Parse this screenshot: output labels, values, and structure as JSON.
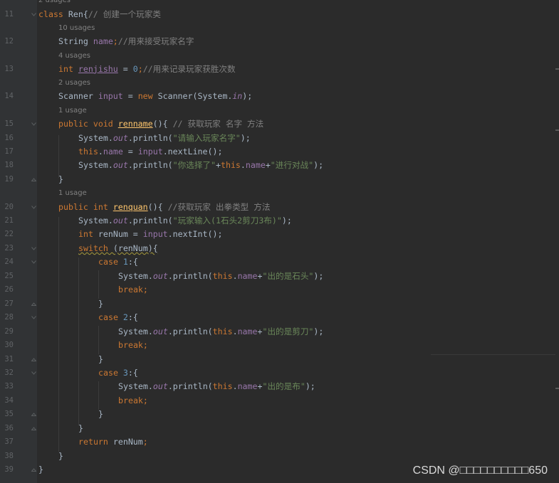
{
  "editor": {
    "top_hint": "2 usages",
    "lines": [
      {
        "kind": "code",
        "num": "11",
        "fold": "open",
        "indent": 0,
        "tokens": [
          {
            "t": "class ",
            "c": "kw"
          },
          {
            "t": "Ren{",
            "c": "p"
          },
          {
            "t": "// 创建一个玩家类",
            "c": "cmt"
          }
        ]
      },
      {
        "kind": "hint",
        "indent": 1,
        "text": "10 usages"
      },
      {
        "kind": "code",
        "num": "12",
        "indent": 1,
        "tokens": [
          {
            "t": "String ",
            "c": "p"
          },
          {
            "t": "name",
            "c": "fld"
          },
          {
            "t": ";",
            "c": "kw"
          },
          {
            "t": "//用来接受玩家名字",
            "c": "cmt"
          }
        ]
      },
      {
        "kind": "hint",
        "indent": 1,
        "text": "4 usages"
      },
      {
        "kind": "code",
        "num": "13",
        "indent": 1,
        "tokens": [
          {
            "t": "int ",
            "c": "kw"
          },
          {
            "t": "renjishu",
            "c": "fldu"
          },
          {
            "t": " = ",
            "c": "p"
          },
          {
            "t": "0",
            "c": "num"
          },
          {
            "t": ";",
            "c": "kw"
          },
          {
            "t": "//用来记录玩家获胜次数",
            "c": "cmt"
          }
        ]
      },
      {
        "kind": "hint",
        "indent": 1,
        "text": "2 usages"
      },
      {
        "kind": "code",
        "num": "14",
        "indent": 1,
        "tokens": [
          {
            "t": "Scanner ",
            "c": "p"
          },
          {
            "t": "input",
            "c": "fld"
          },
          {
            "t": " = ",
            "c": "p"
          },
          {
            "t": "new ",
            "c": "kw"
          },
          {
            "t": "Scanner(System.",
            "c": "p"
          },
          {
            "t": "in",
            "c": "sfld"
          },
          {
            "t": ");",
            "c": "p"
          }
        ]
      },
      {
        "kind": "hint",
        "indent": 1,
        "text": "1 usage"
      },
      {
        "kind": "code",
        "num": "15",
        "fold": "open",
        "indent": 1,
        "tokens": [
          {
            "t": "public void ",
            "c": "kw"
          },
          {
            "t": "renname",
            "c": "fn"
          },
          {
            "t": "(){ ",
            "c": "p"
          },
          {
            "t": "// 获取玩家 名字 方法",
            "c": "cmt"
          }
        ]
      },
      {
        "kind": "code",
        "num": "16",
        "indent": 2,
        "tokens": [
          {
            "t": "System.",
            "c": "p"
          },
          {
            "t": "out",
            "c": "sfld"
          },
          {
            "t": ".println(",
            "c": "p"
          },
          {
            "t": "\"请输入玩家名字\"",
            "c": "str"
          },
          {
            "t": ");",
            "c": "p"
          }
        ]
      },
      {
        "kind": "code",
        "num": "17",
        "indent": 2,
        "tokens": [
          {
            "t": "this",
            "c": "kw"
          },
          {
            "t": ".",
            "c": "p"
          },
          {
            "t": "name",
            "c": "fld"
          },
          {
            "t": " = ",
            "c": "p"
          },
          {
            "t": "input",
            "c": "fld"
          },
          {
            "t": ".nextLine();",
            "c": "p"
          }
        ]
      },
      {
        "kind": "code",
        "num": "18",
        "indent": 2,
        "tokens": [
          {
            "t": "System.",
            "c": "p"
          },
          {
            "t": "out",
            "c": "sfld"
          },
          {
            "t": ".println(",
            "c": "p"
          },
          {
            "t": "\"你选择了\"",
            "c": "str"
          },
          {
            "t": "+",
            "c": "p"
          },
          {
            "t": "this",
            "c": "kw"
          },
          {
            "t": ".",
            "c": "p"
          },
          {
            "t": "name",
            "c": "fld"
          },
          {
            "t": "+",
            "c": "p"
          },
          {
            "t": "\"进行对战\"",
            "c": "str"
          },
          {
            "t": ");",
            "c": "p"
          }
        ]
      },
      {
        "kind": "code",
        "num": "19",
        "fold": "close",
        "indent": 1,
        "tokens": [
          {
            "t": "}",
            "c": "p"
          }
        ]
      },
      {
        "kind": "hint",
        "indent": 1,
        "text": "1 usage"
      },
      {
        "kind": "code",
        "num": "20",
        "fold": "open",
        "indent": 1,
        "tokens": [
          {
            "t": "public int ",
            "c": "kw"
          },
          {
            "t": "renquan",
            "c": "fn"
          },
          {
            "t": "(){ ",
            "c": "p"
          },
          {
            "t": "//获取玩家 出拳类型 方法",
            "c": "cmt"
          }
        ]
      },
      {
        "kind": "code",
        "num": "21",
        "indent": 2,
        "tokens": [
          {
            "t": "System.",
            "c": "p"
          },
          {
            "t": "out",
            "c": "sfld"
          },
          {
            "t": ".println(",
            "c": "p"
          },
          {
            "t": "\"玩家输入(1石头2剪刀3布)\"",
            "c": "str"
          },
          {
            "t": ");",
            "c": "p"
          }
        ]
      },
      {
        "kind": "code",
        "num": "22",
        "indent": 2,
        "tokens": [
          {
            "t": "int ",
            "c": "kw"
          },
          {
            "t": "renNum = ",
            "c": "p"
          },
          {
            "t": "input",
            "c": "fld"
          },
          {
            "t": ".nextInt();",
            "c": "p"
          }
        ]
      },
      {
        "kind": "code",
        "num": "23",
        "fold": "open",
        "indent": 2,
        "tokens": [
          {
            "t": "switch",
            "c": "kwsq"
          },
          {
            "t": " (renNum){",
            "c": "sq"
          }
        ]
      },
      {
        "kind": "code",
        "num": "24",
        "fold": "open",
        "indent": 3,
        "tokens": [
          {
            "t": "case ",
            "c": "kw"
          },
          {
            "t": "1",
            "c": "num"
          },
          {
            "t": ":{",
            "c": "p"
          }
        ]
      },
      {
        "kind": "code",
        "num": "25",
        "indent": 4,
        "tokens": [
          {
            "t": "System.",
            "c": "p"
          },
          {
            "t": "out",
            "c": "sfld"
          },
          {
            "t": ".println(",
            "c": "p"
          },
          {
            "t": "this",
            "c": "kw"
          },
          {
            "t": ".",
            "c": "p"
          },
          {
            "t": "name",
            "c": "fld"
          },
          {
            "t": "+",
            "c": "p"
          },
          {
            "t": "\"出的是石头\"",
            "c": "str"
          },
          {
            "t": ");",
            "c": "p"
          }
        ]
      },
      {
        "kind": "code",
        "num": "26",
        "indent": 4,
        "tokens": [
          {
            "t": "break",
            "c": "kw"
          },
          {
            "t": ";",
            "c": "kw"
          }
        ]
      },
      {
        "kind": "code",
        "num": "27",
        "fold": "close",
        "indent": 3,
        "tokens": [
          {
            "t": "}",
            "c": "p"
          }
        ]
      },
      {
        "kind": "code",
        "num": "28",
        "fold": "open",
        "indent": 3,
        "tokens": [
          {
            "t": "case ",
            "c": "kw"
          },
          {
            "t": "2",
            "c": "num"
          },
          {
            "t": ":{",
            "c": "p"
          }
        ]
      },
      {
        "kind": "code",
        "num": "29",
        "indent": 4,
        "tokens": [
          {
            "t": "System.",
            "c": "p"
          },
          {
            "t": "out",
            "c": "sfld"
          },
          {
            "t": ".println(",
            "c": "p"
          },
          {
            "t": "this",
            "c": "kw"
          },
          {
            "t": ".",
            "c": "p"
          },
          {
            "t": "name",
            "c": "fld"
          },
          {
            "t": "+",
            "c": "p"
          },
          {
            "t": "\"出的是剪刀\"",
            "c": "str"
          },
          {
            "t": ");",
            "c": "p"
          }
        ]
      },
      {
        "kind": "code",
        "num": "30",
        "indent": 4,
        "tokens": [
          {
            "t": "break",
            "c": "kw"
          },
          {
            "t": ";",
            "c": "kw"
          }
        ]
      },
      {
        "kind": "code",
        "num": "31",
        "fold": "close",
        "indent": 3,
        "tokens": [
          {
            "t": "}",
            "c": "p"
          }
        ]
      },
      {
        "kind": "code",
        "num": "32",
        "fold": "open",
        "indent": 3,
        "tokens": [
          {
            "t": "case ",
            "c": "kw"
          },
          {
            "t": "3",
            "c": "num"
          },
          {
            "t": ":{",
            "c": "p"
          }
        ]
      },
      {
        "kind": "code",
        "num": "33",
        "indent": 4,
        "tokens": [
          {
            "t": "System.",
            "c": "p"
          },
          {
            "t": "out",
            "c": "sfld"
          },
          {
            "t": ".println(",
            "c": "p"
          },
          {
            "t": "this",
            "c": "kw"
          },
          {
            "t": ".",
            "c": "p"
          },
          {
            "t": "name",
            "c": "fld"
          },
          {
            "t": "+",
            "c": "p"
          },
          {
            "t": "\"出的是布\"",
            "c": "str"
          },
          {
            "t": ");",
            "c": "p"
          }
        ]
      },
      {
        "kind": "code",
        "num": "34",
        "indent": 4,
        "tokens": [
          {
            "t": "break",
            "c": "kw"
          },
          {
            "t": ";",
            "c": "kw"
          }
        ]
      },
      {
        "kind": "code",
        "num": "35",
        "fold": "close",
        "indent": 3,
        "tokens": [
          {
            "t": "}",
            "c": "p"
          }
        ]
      },
      {
        "kind": "code",
        "num": "36",
        "fold": "close",
        "indent": 2,
        "tokens": [
          {
            "t": "}",
            "c": "p"
          }
        ]
      },
      {
        "kind": "code",
        "num": "37",
        "indent": 2,
        "tokens": [
          {
            "t": "return ",
            "c": "kw"
          },
          {
            "t": "renNum",
            "c": "p"
          },
          {
            "t": ";",
            "c": "kw"
          }
        ]
      },
      {
        "kind": "code",
        "num": "38",
        "indent": 1,
        "tokens": [
          {
            "t": "}",
            "c": "p"
          }
        ]
      },
      {
        "kind": "code",
        "num": "39",
        "fold": "close",
        "indent": 0,
        "tokens": [
          {
            "t": "}",
            "c": "p"
          }
        ]
      }
    ]
  },
  "watermark": "CSDN @□□□□□□□□□□650",
  "colors": {
    "background": "#2b2b2b",
    "gutter": "#313335",
    "keyword": "#cc7832",
    "field": "#9876aa",
    "string": "#6a8759",
    "comment": "#808080",
    "number": "#6897bb",
    "method": "#ffc66d",
    "plain": "#a9b7c6"
  }
}
